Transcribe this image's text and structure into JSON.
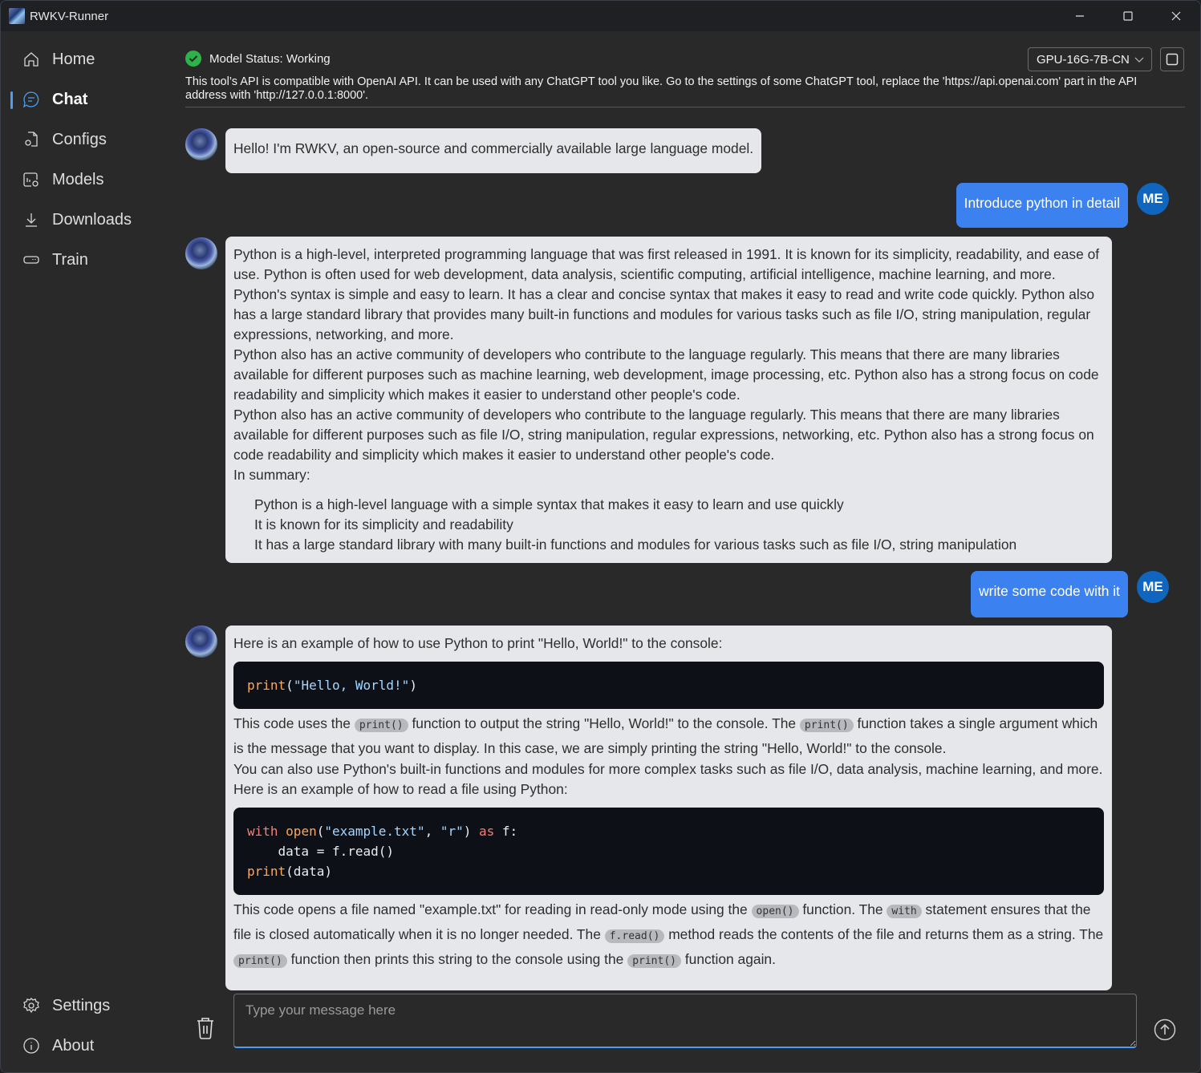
{
  "window": {
    "title": "RWKV-Runner"
  },
  "sidebar": {
    "items": [
      {
        "id": "home",
        "label": "Home",
        "icon": "home-icon",
        "active": false
      },
      {
        "id": "chat",
        "label": "Chat",
        "icon": "chat-icon",
        "active": true
      },
      {
        "id": "configs",
        "label": "Configs",
        "icon": "config-document-icon",
        "active": false
      },
      {
        "id": "models",
        "label": "Models",
        "icon": "model-settings-icon",
        "active": false
      },
      {
        "id": "downloads",
        "label": "Downloads",
        "icon": "download-icon",
        "active": false
      },
      {
        "id": "train",
        "label": "Train",
        "icon": "train-icon",
        "active": false
      }
    ],
    "bottom_items": [
      {
        "id": "settings",
        "label": "Settings",
        "icon": "gear-icon"
      },
      {
        "id": "about",
        "label": "About",
        "icon": "info-icon"
      }
    ]
  },
  "header": {
    "status_label": "Model Status: Working",
    "status_color": "#2eb34b",
    "preset_selected": "GPU-16G-7B-CN",
    "api_note": "This tool’s API is compatible with OpenAI API. It can be used with any ChatGPT tool you like. Go to the settings of some ChatGPT tool, replace the 'https://api.openai.com' part in the API address with 'http://127.0.0.1:8000'."
  },
  "colors": {
    "accent": "#4a9ff5",
    "user_bubble": "#3b82f0",
    "user_avatar": "#1066bf",
    "bot_bubble": "#e6e7ea"
  },
  "chat": {
    "user_avatar_label": "ME",
    "messages": [
      {
        "role": "bot",
        "text": "Hello! I'm RWKV, an open-source and commercially available large language model."
      },
      {
        "role": "user",
        "text": "Introduce python in detail"
      },
      {
        "role": "bot",
        "paragraphs": [
          "Python is a high-level, interpreted programming language that was first released in 1991. It is known for its simplicity, readability, and ease of use. Python is often used for web development, data analysis, scientific computing, artificial intelligence, machine learning, and more.",
          "Python's syntax is simple and easy to learn. It has a clear and concise syntax that makes it easy to read and write code quickly. Python also has a large standard library that provides many built-in functions and modules for various tasks such as file I/O, string manipulation, regular expressions, networking, and more.",
          "Python also has an active community of developers who contribute to the language regularly. This means that there are many libraries available for different purposes such as machine learning, web development, image processing, etc. Python also has a strong focus on code readability and simplicity which makes it easier to understand other people's code.",
          "Python also has an active community of developers who contribute to the language regularly. This means that there are many libraries available for different purposes such as file I/O, string manipulation, regular expressions, networking, etc. Python also has a strong focus on code readability and simplicity which makes it easier to understand other people's code.",
          "In summary:"
        ],
        "list": [
          "Python is a high-level language with a simple syntax that makes it easy to learn and use quickly",
          "It is known for its simplicity and readability",
          "It has a large standard library with many built-in functions and modules for various tasks such as file I/O, string manipulation"
        ]
      },
      {
        "role": "user",
        "text": "write some code with it"
      },
      {
        "role": "bot",
        "intro": "Here is an example of how to use Python to print \"Hello, World!\" to the console:",
        "code1": {
          "fn": "print",
          "open": "(",
          "str": "\"Hello, World!\"",
          "close": ")"
        },
        "p1_a": "This code uses the ",
        "p1_code1": "print()",
        "p1_b": " function to output the string \"Hello, World!\" to the console. The ",
        "p1_code2": "print()",
        "p1_c": " function takes a single argument which is the message that you want to display. In this case, we are simply printing the string \"Hello, World!\" to the console.",
        "p2": "You can also use Python's built-in functions and modules for more complex tasks such as file I/O, data analysis, machine learning, and more.",
        "p3": "Here is an example of how to read a file using Python:",
        "code2": {
          "l1_kw": "with",
          "l1_fn": "open",
          "l1_a": "(",
          "l1_s1": "\"example.txt\"",
          "l1_b": ", ",
          "l1_s2": "\"r\"",
          "l1_c": ") ",
          "l1_kw2": "as",
          "l1_d": " f:",
          "l2": "    data = f.read()",
          "l3_fn": "print",
          "l3_rest": "(data)"
        },
        "p4_a": "This code opens a file named \"example.txt\" for reading in read-only mode using the ",
        "p4_code1": "open()",
        "p4_b": " function. The ",
        "p4_code2": "with",
        "p4_c": " statement ensures that the file is closed automatically when it is no longer needed. The ",
        "p4_code3": "f.read()",
        "p4_d": " method reads the contents of the file and returns them as a string. The ",
        "p4_code4": "print()",
        "p4_e": " function then prints this string to the console using the ",
        "p4_code5": "print()",
        "p4_f": " function again."
      }
    ]
  },
  "composer": {
    "placeholder": "Type your message here",
    "value": ""
  }
}
